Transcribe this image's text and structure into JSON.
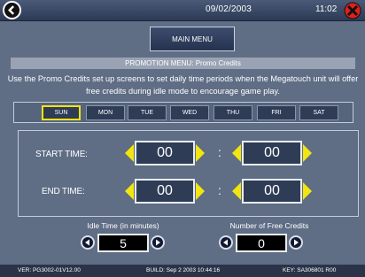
{
  "topbar": {
    "date": "09/02/2003",
    "time": "11:02",
    "back_icon": "back-arrow-icon",
    "close_icon": "close-x-icon"
  },
  "main_menu_label": "MAIN MENU",
  "menu_title": "PROMOTION MENU: Promo Credits",
  "description": "Use the Promo Credits set up screens to set daily time periods when the Megatouch unit will offer free credits during idle mode to encourage game play.",
  "days": [
    "SUN",
    "MON",
    "TUE",
    "WED",
    "THU",
    "FRI",
    "SAT"
  ],
  "selected_day": "SUN",
  "start_time": {
    "label": "START TIME:",
    "hour": "00",
    "minute": "00"
  },
  "end_time": {
    "label": "END TIME:",
    "hour": "00",
    "minute": "00"
  },
  "idle_time": {
    "label": "Idle Time (in minutes)",
    "value": "5"
  },
  "free_credits": {
    "label": "Number of Free Credits",
    "value": "0"
  },
  "footer": {
    "version": "VER:  PG3002-01V12.00",
    "build": "BUILD:  Sep  2 2003  10:44:16",
    "key": "KEY:  SA306801 R00"
  },
  "colors": {
    "accent_yellow": "#f2e510",
    "background": "#5f6d85",
    "close_red": "#e0201b"
  }
}
